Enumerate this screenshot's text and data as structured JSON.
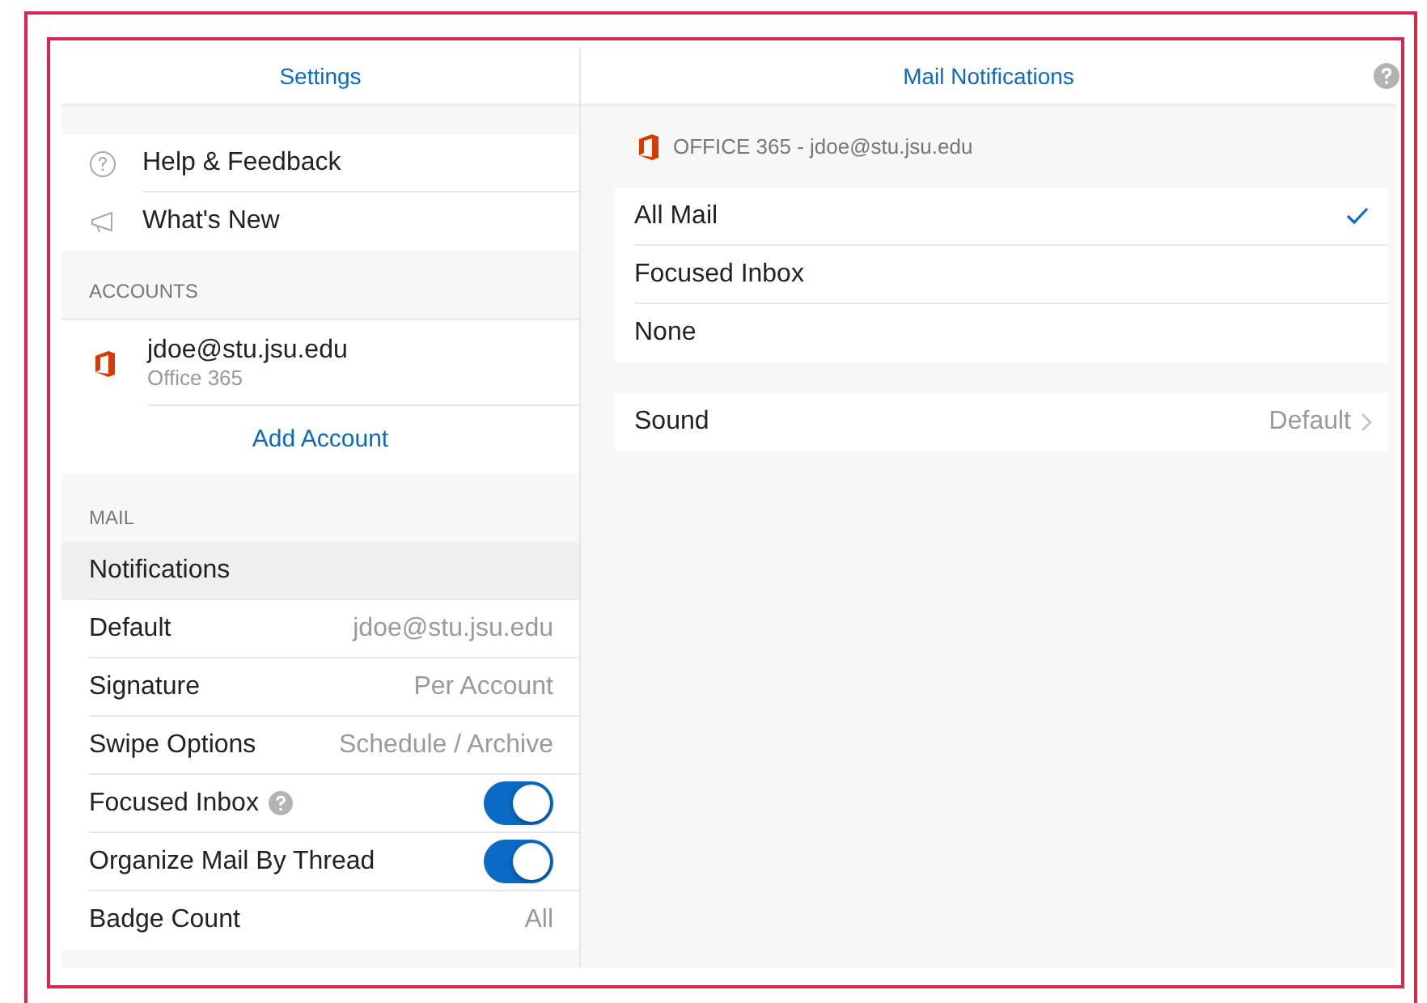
{
  "sidebar": {
    "title": "Settings",
    "top_items": [
      {
        "label": "Help & Feedback"
      },
      {
        "label": "What's New"
      }
    ],
    "accounts": {
      "header": "ACCOUNTS",
      "items": [
        {
          "email": "jdoe@stu.jsu.edu",
          "type": "Office 365"
        }
      ],
      "add_label": "Add Account"
    },
    "mail": {
      "header": "MAIL",
      "rows": [
        {
          "kind": "nav",
          "label": "Notifications",
          "selected": true
        },
        {
          "kind": "value",
          "label": "Default",
          "value": "jdoe@stu.jsu.edu",
          "selected": false
        },
        {
          "kind": "value",
          "label": "Signature",
          "value": "Per Account",
          "selected": false
        },
        {
          "kind": "value",
          "label": "Swipe Options",
          "value": "Schedule / Archive",
          "selected": false
        },
        {
          "kind": "toggle",
          "label": "Focused Inbox",
          "on": true,
          "help": true,
          "selected": false
        },
        {
          "kind": "toggle",
          "label": "Organize Mail By Thread",
          "on": true,
          "help": false,
          "selected": false
        },
        {
          "kind": "value",
          "label": "Badge Count",
          "value": "All",
          "selected": false
        }
      ]
    }
  },
  "detail": {
    "title": "Mail Notifications",
    "account": "OFFICE 365 - jdoe@stu.jsu.edu",
    "options": [
      {
        "label": "All Mail",
        "selected": true
      },
      {
        "label": "Focused Inbox",
        "selected": false
      },
      {
        "label": "None",
        "selected": false
      }
    ],
    "sound": {
      "label": "Sound",
      "value": "Default"
    }
  }
}
